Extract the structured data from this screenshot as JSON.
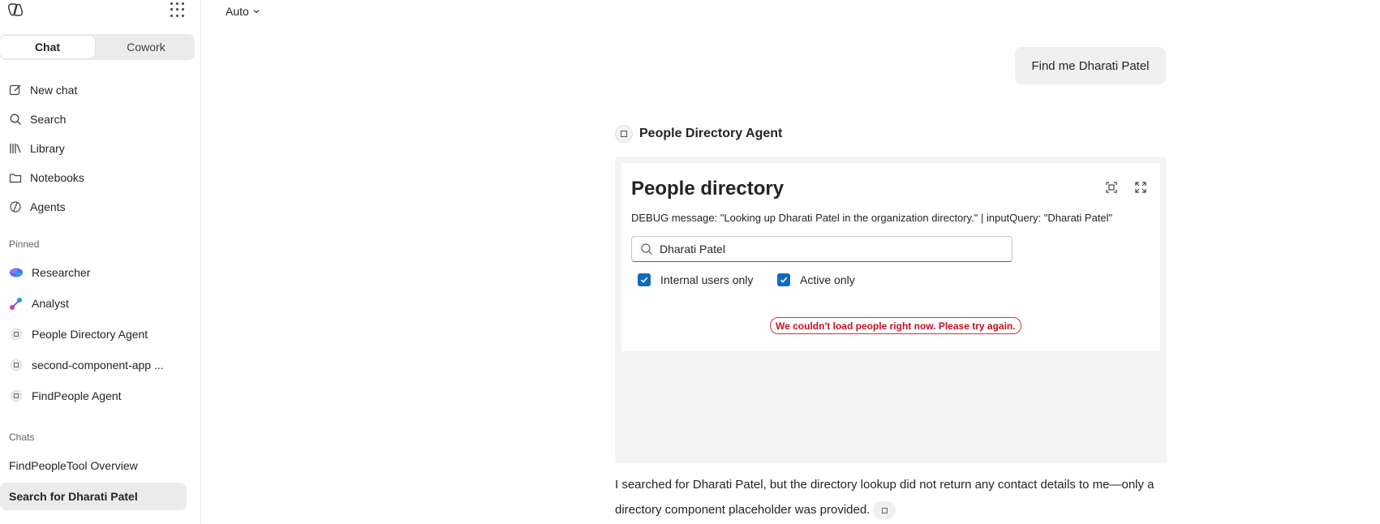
{
  "model_selector": {
    "label": "Auto"
  },
  "sidebar": {
    "tabs": {
      "chat": "Chat",
      "cowork": "Cowork"
    },
    "nav": [
      {
        "label": "New chat",
        "icon": "compose-icon"
      },
      {
        "label": "Search",
        "icon": "search-icon"
      },
      {
        "label": "Library",
        "icon": "library-icon"
      },
      {
        "label": "Notebooks",
        "icon": "folder-icon"
      },
      {
        "label": "Agents",
        "icon": "agents-icon"
      }
    ],
    "pinned_label": "Pinned",
    "pinned": [
      {
        "label": "Researcher",
        "icon": "researcher-icon"
      },
      {
        "label": "Analyst",
        "icon": "analyst-icon"
      },
      {
        "label": "People Directory Agent",
        "icon": "agent-icon"
      },
      {
        "label": "second-component-app ...",
        "icon": "agent-icon"
      },
      {
        "label": "FindPeople Agent",
        "icon": "agent-icon"
      }
    ],
    "chats_label": "Chats",
    "chats": [
      {
        "label": "FindPeopleTool Overview",
        "active": false
      },
      {
        "label": "Search for Dharati Patel",
        "active": true
      }
    ]
  },
  "conversation": {
    "user_message": "Find me Dharati Patel",
    "agent_name": "People Directory Agent",
    "card": {
      "title": "People directory",
      "debug": "DEBUG message: \"Looking up Dharati Patel in the organization directory.\" | inputQuery: \"Dharati Patel\"",
      "search_value": "Dharati Patel",
      "checkbox_internal": "Internal users only",
      "checkbox_active": "Active only",
      "error": "We couldn't load people right now. Please try again."
    },
    "answer": "I searched for Dharati Patel, but the directory lookup did not return any contact details to me—only a directory component placeholder was provided."
  },
  "colors": {
    "accent": "#0f6cbd",
    "error": "#c50f1f"
  }
}
